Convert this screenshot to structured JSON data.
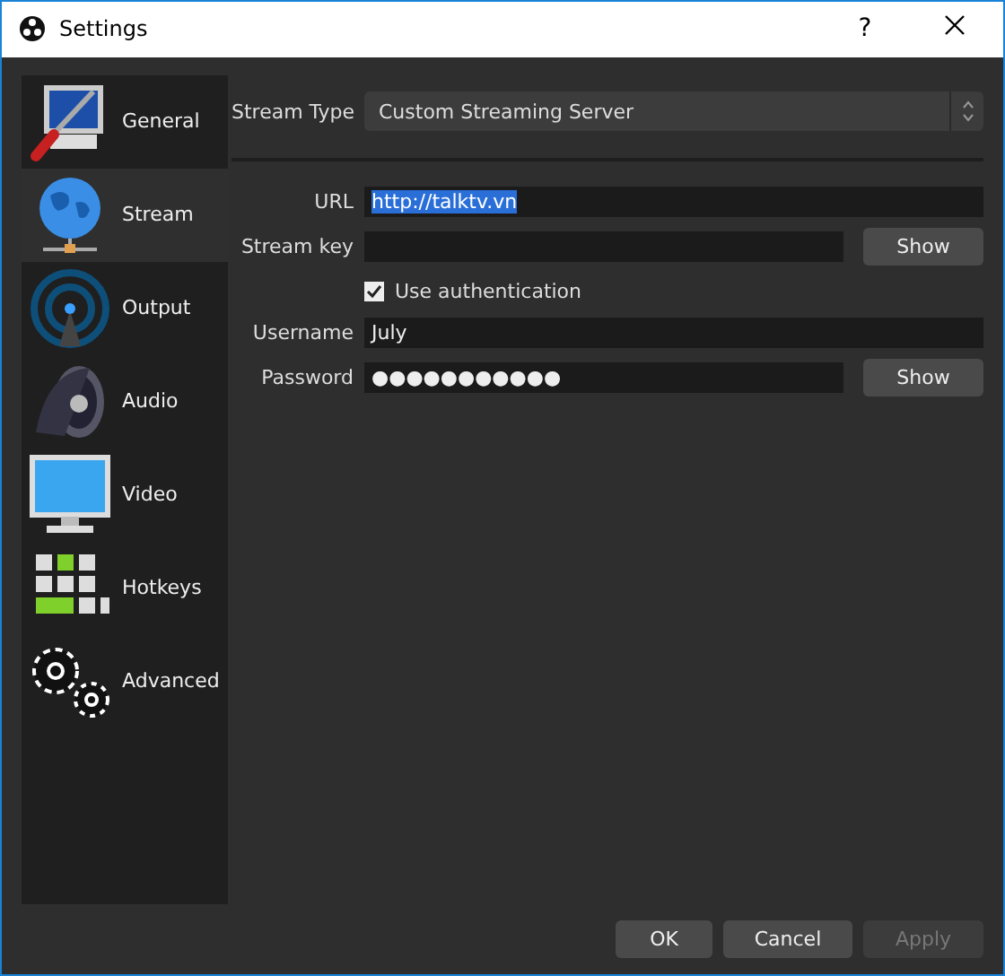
{
  "window": {
    "title": "Settings",
    "help": "?"
  },
  "sidebar": {
    "items": [
      {
        "label": "General",
        "selected": false
      },
      {
        "label": "Stream",
        "selected": true
      },
      {
        "label": "Output",
        "selected": false
      },
      {
        "label": "Audio",
        "selected": false
      },
      {
        "label": "Video",
        "selected": false
      },
      {
        "label": "Hotkeys",
        "selected": false
      },
      {
        "label": "Advanced",
        "selected": false
      }
    ]
  },
  "stream_type": {
    "label": "Stream Type",
    "value": "Custom Streaming Server"
  },
  "form": [
    {
      "kind": "field",
      "label": "URL",
      "value": "http://talktv.vn",
      "highlighted": true
    },
    {
      "kind": "field",
      "label": "Stream key",
      "button": "Show"
    },
    {
      "kind": "checkbox",
      "label": "Use authentication",
      "checked": true
    },
    {
      "kind": "field",
      "label": "Username",
      "value": "July"
    },
    {
      "kind": "field",
      "label": "Password",
      "value": "●●●●●●●●●●●",
      "button": "Show"
    }
  ],
  "buttons": [
    {
      "label": "OK",
      "disabled": false
    },
    {
      "label": "Cancel",
      "disabled": false
    },
    {
      "label": "Apply",
      "disabled": true
    }
  ]
}
